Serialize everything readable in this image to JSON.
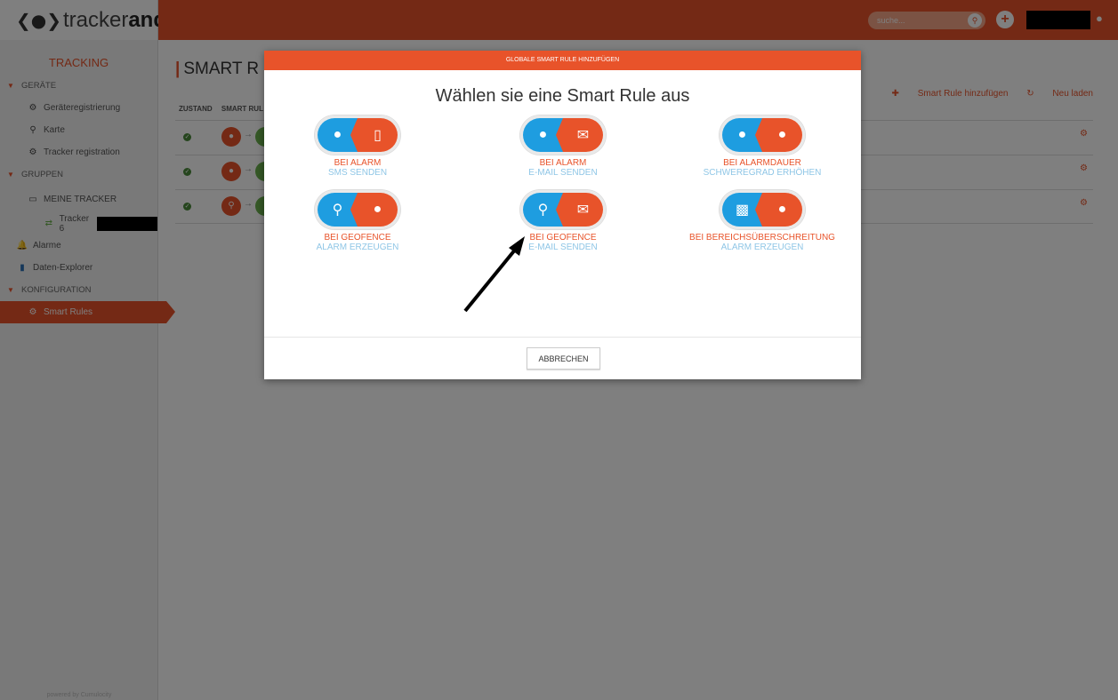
{
  "app": {
    "logo_text": "tracker",
    "logo_bold": "ando",
    "search_placeholder": "suche..."
  },
  "sidebar": {
    "title": "TRACKING",
    "devices_section": "GERÄTE",
    "device_items": [
      "Geräteregistrierung",
      "Karte",
      "Tracker registration"
    ],
    "groups_section": "GRUPPEN",
    "my_trackers": "MEINE TRACKER",
    "tracker_item": "Tracker 6",
    "alarms": "Alarme",
    "data_explorer": "Daten-Explorer",
    "config_section": "KONFIGURATION",
    "smart_rules": "Smart Rules",
    "powered_by": "powered by Cumulocity"
  },
  "main": {
    "title": "SMART R",
    "add_action": "Smart Rule hinzufügen",
    "reload_action": "Neu laden",
    "columns": [
      "ZUSTAND",
      "SMART RUL"
    ]
  },
  "modal": {
    "header": "GLOBALE SMART RULE HINZUFÜGEN",
    "title": "Wählen sie eine Smart Rule aus",
    "rules": [
      {
        "line1": "BEI ALARM",
        "line2": "SMS SENDEN",
        "left_icon": "bell-icon",
        "right_icon": "phone-icon"
      },
      {
        "line1": "BEI ALARM",
        "line2": "E-MAIL SENDEN",
        "left_icon": "bell-icon",
        "right_icon": "envelope-icon"
      },
      {
        "line1": "BEI ALARMDAUER",
        "line2": "SCHWEREGRAD ERHÖHEN",
        "left_icon": "bell-icon",
        "right_icon": "bell-icon"
      },
      {
        "line1": "BEI GEOFENCE",
        "line2": "ALARM ERZEUGEN",
        "left_icon": "map-marker-icon",
        "right_icon": "bell-icon"
      },
      {
        "line1": "BEI GEOFENCE",
        "line2": "E-MAIL SENDEN",
        "left_icon": "map-marker-icon",
        "right_icon": "envelope-icon"
      },
      {
        "line1": "BEI BEREICHSÜBERSCHREITUNG",
        "line2": "ALARM ERZEUGEN",
        "left_icon": "bar-chart-icon",
        "right_icon": "bell-icon"
      }
    ],
    "cancel_label": "ABBRECHEN"
  },
  "colors": {
    "accent": "#e8532a",
    "blue": "#1e9de0",
    "green": "#6ab04c"
  }
}
